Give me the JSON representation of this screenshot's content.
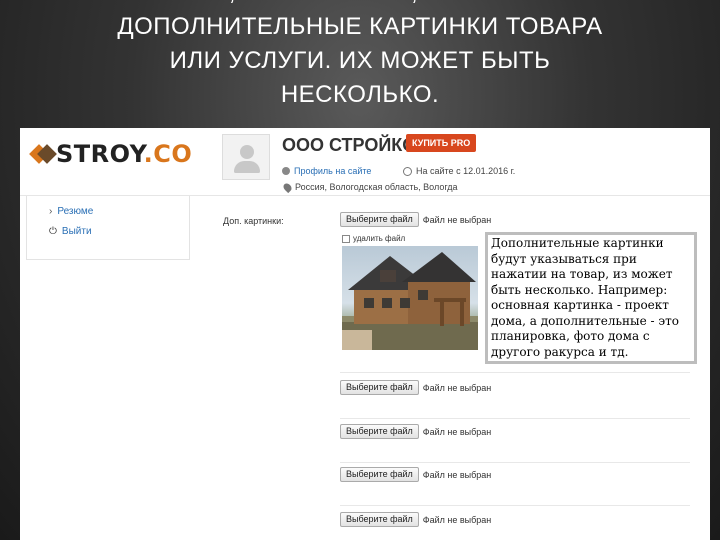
{
  "slide": {
    "title_cut_line": "НИЖЕ, ЕСЛИ НУЖНО, ЗАГРУЗИТЕ",
    "title_lines": [
      "ДОПОЛНИТЕЛЬНЫЕ КАРТИНКИ ТОВАРА",
      "ИЛИ УСЛУГИ. ИХ МОЖЕТ БЫТЬ",
      "НЕСКОЛЬКО."
    ]
  },
  "site": {
    "logo_main": "STROY",
    "logo_accent": ".CO"
  },
  "profile": {
    "company_name": "ООО СТРОЙКО",
    "buy_pro_label": "КУПИТЬ PRO",
    "profile_link": "Профиль на сайте",
    "since_text": "На сайте с 12.01.2016 г.",
    "location_text": "Россия, Вологодская область, Вологда"
  },
  "sidebar": {
    "items": [
      {
        "label": "Резюме"
      },
      {
        "label": "Выйти"
      }
    ]
  },
  "form": {
    "field_label": "Доп. картинки:",
    "choose_button": "Выберите файл",
    "no_file_text": "Файл не выбран",
    "delete_label": "удалить файл"
  },
  "callout": {
    "text": "Дополнительные картинки будут указываться при нажатии на товар, из может быть несколько. Например: основная картинка - проект дома, а дополнительные - это планировка, фото дома с другого ракурса и тд."
  },
  "icons": {
    "profile": "user-icon",
    "since": "clock-icon",
    "location": "pin-icon",
    "resume": "chevron-right-icon",
    "logout": "power-icon"
  },
  "colors": {
    "accent": "#d9761c",
    "buy_pro": "#d8471e",
    "link": "#2a6fb5"
  }
}
